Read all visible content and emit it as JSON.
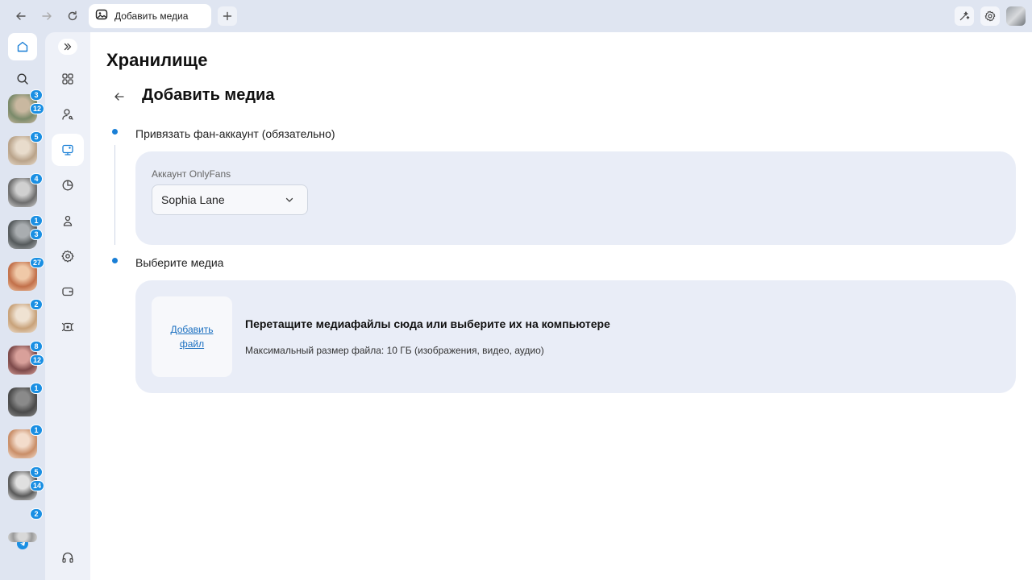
{
  "browser": {
    "tab_title": "Добавить медиа"
  },
  "sidebar": {
    "chats": [
      {
        "badges": [
          "3",
          "12"
        ],
        "colors": [
          "#7a8a6a",
          "#c9b8a0"
        ]
      },
      {
        "badges": [
          "5"
        ],
        "colors": [
          "#b9a38a",
          "#e8dccc"
        ]
      },
      {
        "badges": [
          "4"
        ],
        "colors": [
          "#6d6d6d",
          "#d0d0d0"
        ]
      },
      {
        "badges": [
          "1",
          "3"
        ],
        "colors": [
          "#555a5c",
          "#a9adb0"
        ]
      },
      {
        "badges": [
          "27"
        ],
        "colors": [
          "#c2704a",
          "#f0c9a8"
        ]
      },
      {
        "badges": [
          "2"
        ],
        "colors": [
          "#c8a27a",
          "#efe2d2"
        ]
      },
      {
        "badges": [
          "8",
          "12"
        ],
        "colors": [
          "#7d4a4a",
          "#d8a09a"
        ]
      },
      {
        "badges": [
          "1"
        ],
        "colors": [
          "#4a4a4a",
          "#8a8a8a"
        ]
      },
      {
        "badges": [
          "1"
        ],
        "colors": [
          "#c98e68",
          "#f3dccb"
        ]
      },
      {
        "badges": [
          "5",
          "14"
        ],
        "colors": [
          "#5a5a5a",
          "#e0e0e0"
        ]
      },
      {
        "badges": [
          "2"
        ],
        "colors": [
          "#9a9a9a",
          "#d8d8d8"
        ]
      }
    ]
  },
  "rail": {
    "icons": [
      "dashboard-icon",
      "user-icon",
      "storage-icon",
      "analytics-icon",
      "team-icon",
      "settings-icon",
      "wallet-icon",
      "ai-icon"
    ],
    "active": "storage-icon"
  },
  "main": {
    "page_title": "Хранилище",
    "sub_title": "Добавить медиа",
    "step1": {
      "label": "Привязать фан-аккаунт (обязательно)",
      "field_label": "Аккаунт OnlyFans",
      "selected_account": "Sophia Lane"
    },
    "step2": {
      "label": "Выберите медиа",
      "add_file_link": "Добавить файл",
      "drop_title": "Перетащите медиафайлы сюда или выберите их на компьютере",
      "drop_subtitle": "Максимальный размер файла: 10 ГБ (изображения, видео, аудио)"
    }
  },
  "colors": {
    "accent": "#1a8fe3",
    "card_bg": "#e9edf7",
    "link": "#1a6fc0"
  }
}
